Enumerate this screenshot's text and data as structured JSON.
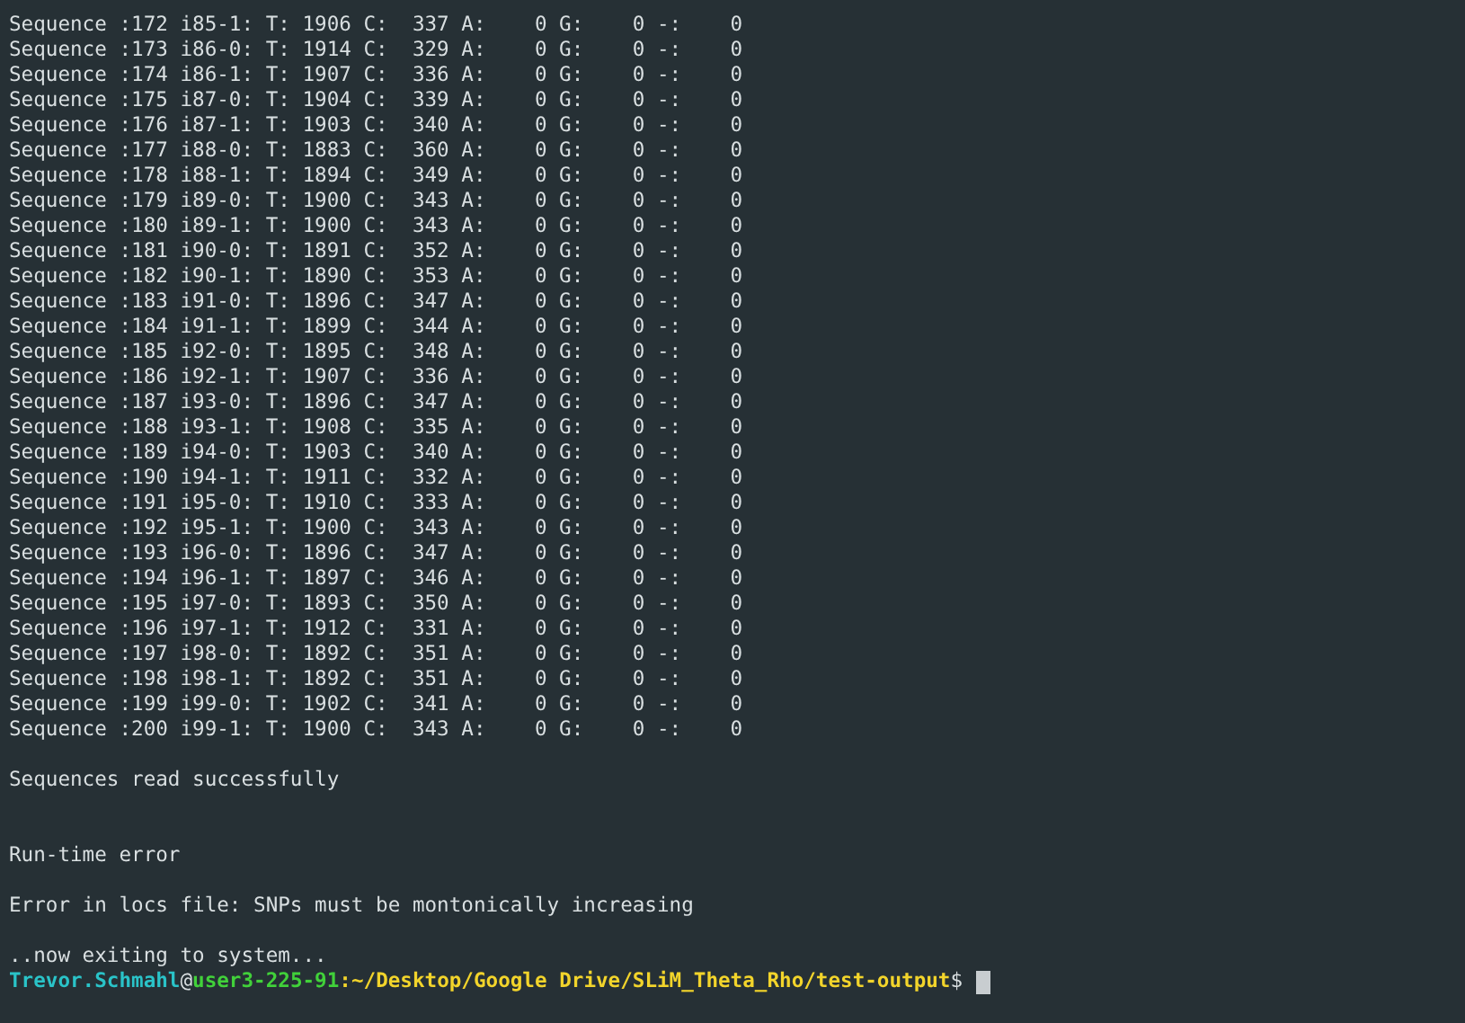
{
  "terminal": {
    "lines": [
      {
        "kind": "sequence",
        "text": "Sequence :172 i85-1: T: 1906 C:  337 A:    0 G:    0 -:    0"
      },
      {
        "kind": "sequence",
        "text": "Sequence :173 i86-0: T: 1914 C:  329 A:    0 G:    0 -:    0"
      },
      {
        "kind": "sequence",
        "text": "Sequence :174 i86-1: T: 1907 C:  336 A:    0 G:    0 -:    0"
      },
      {
        "kind": "sequence",
        "text": "Sequence :175 i87-0: T: 1904 C:  339 A:    0 G:    0 -:    0"
      },
      {
        "kind": "sequence",
        "text": "Sequence :176 i87-1: T: 1903 C:  340 A:    0 G:    0 -:    0"
      },
      {
        "kind": "sequence",
        "text": "Sequence :177 i88-0: T: 1883 C:  360 A:    0 G:    0 -:    0"
      },
      {
        "kind": "sequence",
        "text": "Sequence :178 i88-1: T: 1894 C:  349 A:    0 G:    0 -:    0"
      },
      {
        "kind": "sequence",
        "text": "Sequence :179 i89-0: T: 1900 C:  343 A:    0 G:    0 -:    0"
      },
      {
        "kind": "sequence",
        "text": "Sequence :180 i89-1: T: 1900 C:  343 A:    0 G:    0 -:    0"
      },
      {
        "kind": "sequence",
        "text": "Sequence :181 i90-0: T: 1891 C:  352 A:    0 G:    0 -:    0"
      },
      {
        "kind": "sequence",
        "text": "Sequence :182 i90-1: T: 1890 C:  353 A:    0 G:    0 -:    0"
      },
      {
        "kind": "sequence",
        "text": "Sequence :183 i91-0: T: 1896 C:  347 A:    0 G:    0 -:    0"
      },
      {
        "kind": "sequence",
        "text": "Sequence :184 i91-1: T: 1899 C:  344 A:    0 G:    0 -:    0"
      },
      {
        "kind": "sequence",
        "text": "Sequence :185 i92-0: T: 1895 C:  348 A:    0 G:    0 -:    0"
      },
      {
        "kind": "sequence",
        "text": "Sequence :186 i92-1: T: 1907 C:  336 A:    0 G:    0 -:    0"
      },
      {
        "kind": "sequence",
        "text": "Sequence :187 i93-0: T: 1896 C:  347 A:    0 G:    0 -:    0"
      },
      {
        "kind": "sequence",
        "text": "Sequence :188 i93-1: T: 1908 C:  335 A:    0 G:    0 -:    0"
      },
      {
        "kind": "sequence",
        "text": "Sequence :189 i94-0: T: 1903 C:  340 A:    0 G:    0 -:    0"
      },
      {
        "kind": "sequence",
        "text": "Sequence :190 i94-1: T: 1911 C:  332 A:    0 G:    0 -:    0"
      },
      {
        "kind": "sequence",
        "text": "Sequence :191 i95-0: T: 1910 C:  333 A:    0 G:    0 -:    0"
      },
      {
        "kind": "sequence",
        "text": "Sequence :192 i95-1: T: 1900 C:  343 A:    0 G:    0 -:    0"
      },
      {
        "kind": "sequence",
        "text": "Sequence :193 i96-0: T: 1896 C:  347 A:    0 G:    0 -:    0"
      },
      {
        "kind": "sequence",
        "text": "Sequence :194 i96-1: T: 1897 C:  346 A:    0 G:    0 -:    0"
      },
      {
        "kind": "sequence",
        "text": "Sequence :195 i97-0: T: 1893 C:  350 A:    0 G:    0 -:    0"
      },
      {
        "kind": "sequence",
        "text": "Sequence :196 i97-1: T: 1912 C:  331 A:    0 G:    0 -:    0"
      },
      {
        "kind": "sequence",
        "text": "Sequence :197 i98-0: T: 1892 C:  351 A:    0 G:    0 -:    0"
      },
      {
        "kind": "sequence",
        "text": "Sequence :198 i98-1: T: 1892 C:  351 A:    0 G:    0 -:    0"
      },
      {
        "kind": "sequence",
        "text": "Sequence :199 i99-0: T: 1902 C:  341 A:    0 G:    0 -:    0"
      },
      {
        "kind": "sequence",
        "text": "Sequence :200 i99-1: T: 1900 C:  343 A:    0 G:    0 -:    0"
      },
      {
        "kind": "status",
        "text": "Sequences read successfully"
      },
      {
        "kind": "error-heading",
        "text": "Run-time error"
      },
      {
        "kind": "error-detail",
        "text": "Error in locs file: SNPs must be montonically increasing"
      },
      {
        "kind": "exit-note",
        "text": "..now exiting to system..."
      }
    ],
    "prompt": {
      "user": "Trevor.Schmahl",
      "at": "@",
      "host": "user3-225-91",
      "colon": ":",
      "path": "~/Desktop/Google Drive/SLiM_Theta_Rho/test-output",
      "symbol": "$"
    }
  }
}
